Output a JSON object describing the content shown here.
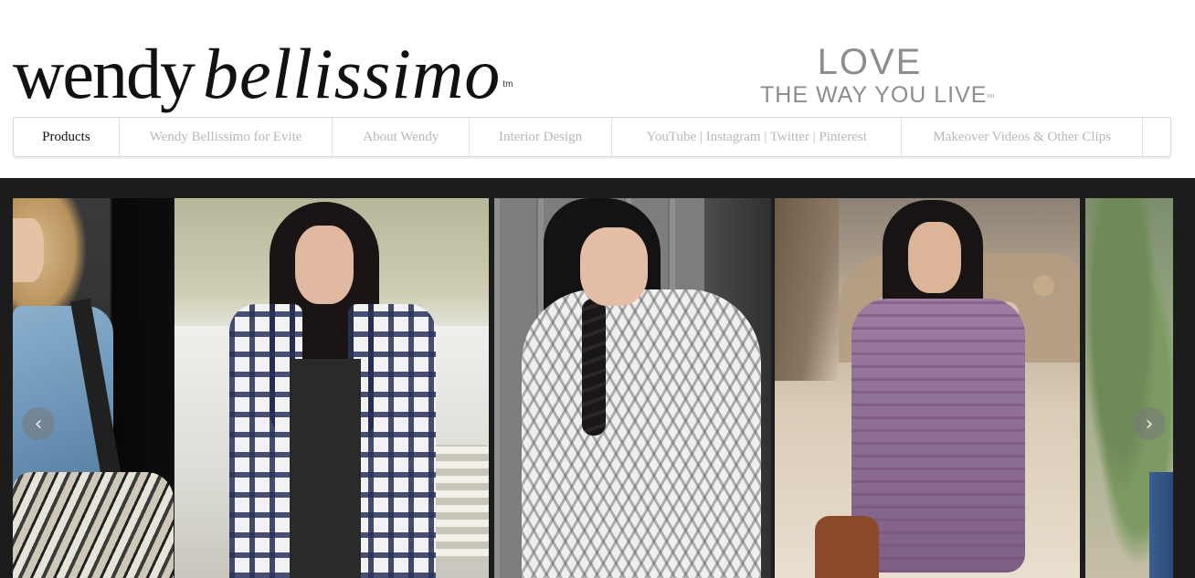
{
  "logo": {
    "part_a": "wendy",
    "part_b": "bellissimo",
    "tm": "tm"
  },
  "tagline": {
    "line1": "LOVE",
    "line2": "THE WAY YOU LIVE",
    "tm": "tm"
  },
  "nav": {
    "items": [
      {
        "label": "Products",
        "active": true
      },
      {
        "label": "Wendy Bellissimo for Evite",
        "active": false
      },
      {
        "label": "About Wendy",
        "active": false
      },
      {
        "label": "Interior Design",
        "active": false
      },
      {
        "label": "YouTube | Instagram | Twitter | Pinterest",
        "active": false
      },
      {
        "label": "Makeover Videos & Other Clips",
        "active": false
      }
    ]
  },
  "carousel": {
    "prev_icon": "chevron-left-icon",
    "next_icon": "chevron-right-icon",
    "prev_glyph": "‹",
    "next_glyph": "›"
  },
  "colors": {
    "nav_active": "#111111",
    "nav_inactive": "#b8b8b8",
    "tagline": "#8d8d8d",
    "gallery_bg": "#1c1c1c"
  }
}
